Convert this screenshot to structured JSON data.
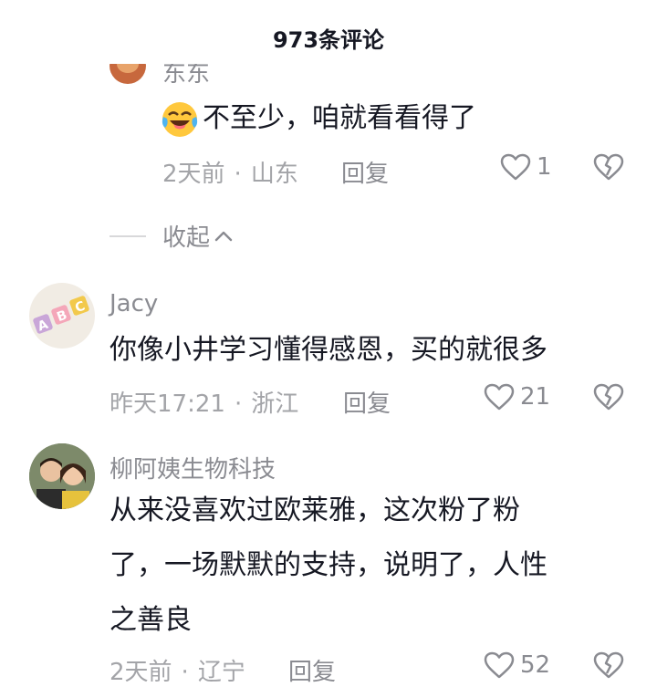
{
  "header": {
    "title": "973条评论"
  },
  "comments": [
    {
      "username": "东东",
      "text": "不至少，咱就看看得了",
      "emoji": "laughing-crying-emoji",
      "time": "2天前",
      "location": "山东",
      "reply_label": "回复",
      "likes": "1"
    },
    {
      "username": "Jacy",
      "text": "你像小井学习懂得感恩，买的就很多",
      "time": "昨天17:21",
      "location": "浙江",
      "reply_label": "回复",
      "likes": "21"
    },
    {
      "username": "柳阿姨生物科技",
      "text_lines": [
        "从来没喜欢过欧莱雅，这次粉了粉",
        "了，一场默默的支持，说明了，人性",
        "之善良"
      ],
      "time": "2天前",
      "location": "辽宁",
      "reply_label": "回复",
      "likes": "52"
    }
  ],
  "collapse": {
    "label": "收起"
  },
  "colors": {
    "text": "#161823",
    "secondary": "#8a8b91",
    "meta": "#a3a4a8"
  }
}
